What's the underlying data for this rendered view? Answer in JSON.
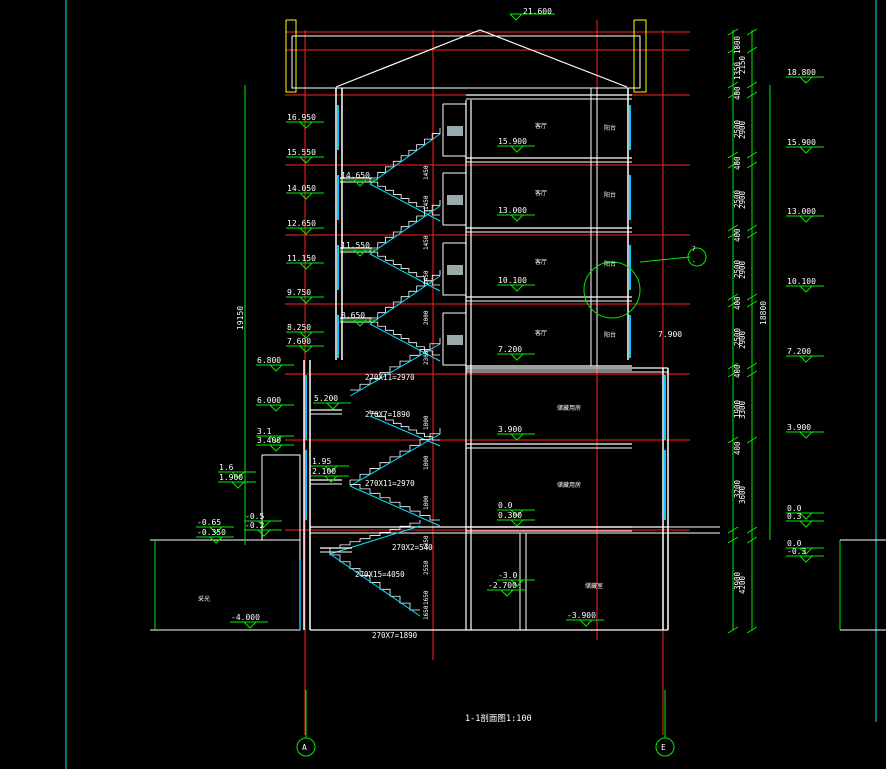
{
  "colors": {
    "background": "#000000",
    "wall": "#ffffff",
    "axis": "#ff2020",
    "dimension": "#00ee00",
    "stair": "#00e5ff",
    "window": "#00c8ff",
    "roof_edge": "#ffff00"
  },
  "title": {
    "name": "1-1剖面图",
    "scale": "1:100"
  },
  "axes": [
    "A",
    "E"
  ],
  "left_elevations": [
    "16.950",
    "15.550",
    "14.050",
    "12.650",
    "11.150",
    "9.750",
    "8.250",
    "7.600",
    "6.800",
    "6.000",
    "3.1",
    "3.400",
    "1.6",
    "1.900",
    "-0.65",
    "-0.350",
    "-0.5",
    "-0.2"
  ],
  "right_elevations": [
    "18.800",
    "15.900",
    "13.000",
    "10.100",
    "7.200",
    "3.900",
    "0.0",
    "0.3",
    "0.0",
    "-0.3"
  ],
  "floor_elevations": [
    "15.900",
    "13.000",
    "10.100",
    "7.200",
    "3.900",
    "0.0",
    "0.300",
    "-3.0",
    "-2.700",
    "-3.900"
  ],
  "landing_elevations": [
    "14.650",
    "11.550",
    "8.650",
    "5.200",
    "1.95",
    "2.100",
    "-4.000"
  ],
  "top_elevation": "21.600",
  "right_dims_inner": [
    "1800",
    "1350",
    "400",
    "2500",
    "400",
    "2500",
    "400",
    "2500",
    "400",
    "2500",
    "400",
    "1900",
    "400",
    "3200",
    "3900"
  ],
  "right_dims_outer": [
    "2150",
    "2900",
    "2900",
    "2900",
    "2900",
    "3300",
    "3600",
    "4200"
  ],
  "left_total": "19150",
  "right_total": "18800",
  "stair_runs": [
    "270X11=2970",
    "270X7=1890",
    "270X11=2970",
    "270X2=540",
    "270X15=4050",
    "270X7=1890"
  ],
  "stair_vertical": [
    "1450",
    "1450",
    "1450",
    "1450",
    "2000",
    "2300",
    "1800",
    "1800",
    "1800",
    "1350",
    "2550",
    "1650",
    "1650"
  ],
  "rooms": {
    "upper": [
      "客厅",
      "客厅",
      "客厅",
      "客厅"
    ],
    "upper_right": [
      "阳台",
      "阳台",
      "阳台",
      "阳台"
    ],
    "lower": [
      "储藏用房",
      "储藏用房"
    ],
    "basement": "储藏室",
    "outside": "采光"
  },
  "section_mark": {
    "number": "7",
    "sheet": "-"
  },
  "side_labels": {
    "right_level_a": "7.900",
    "left_lower": "0.5"
  }
}
